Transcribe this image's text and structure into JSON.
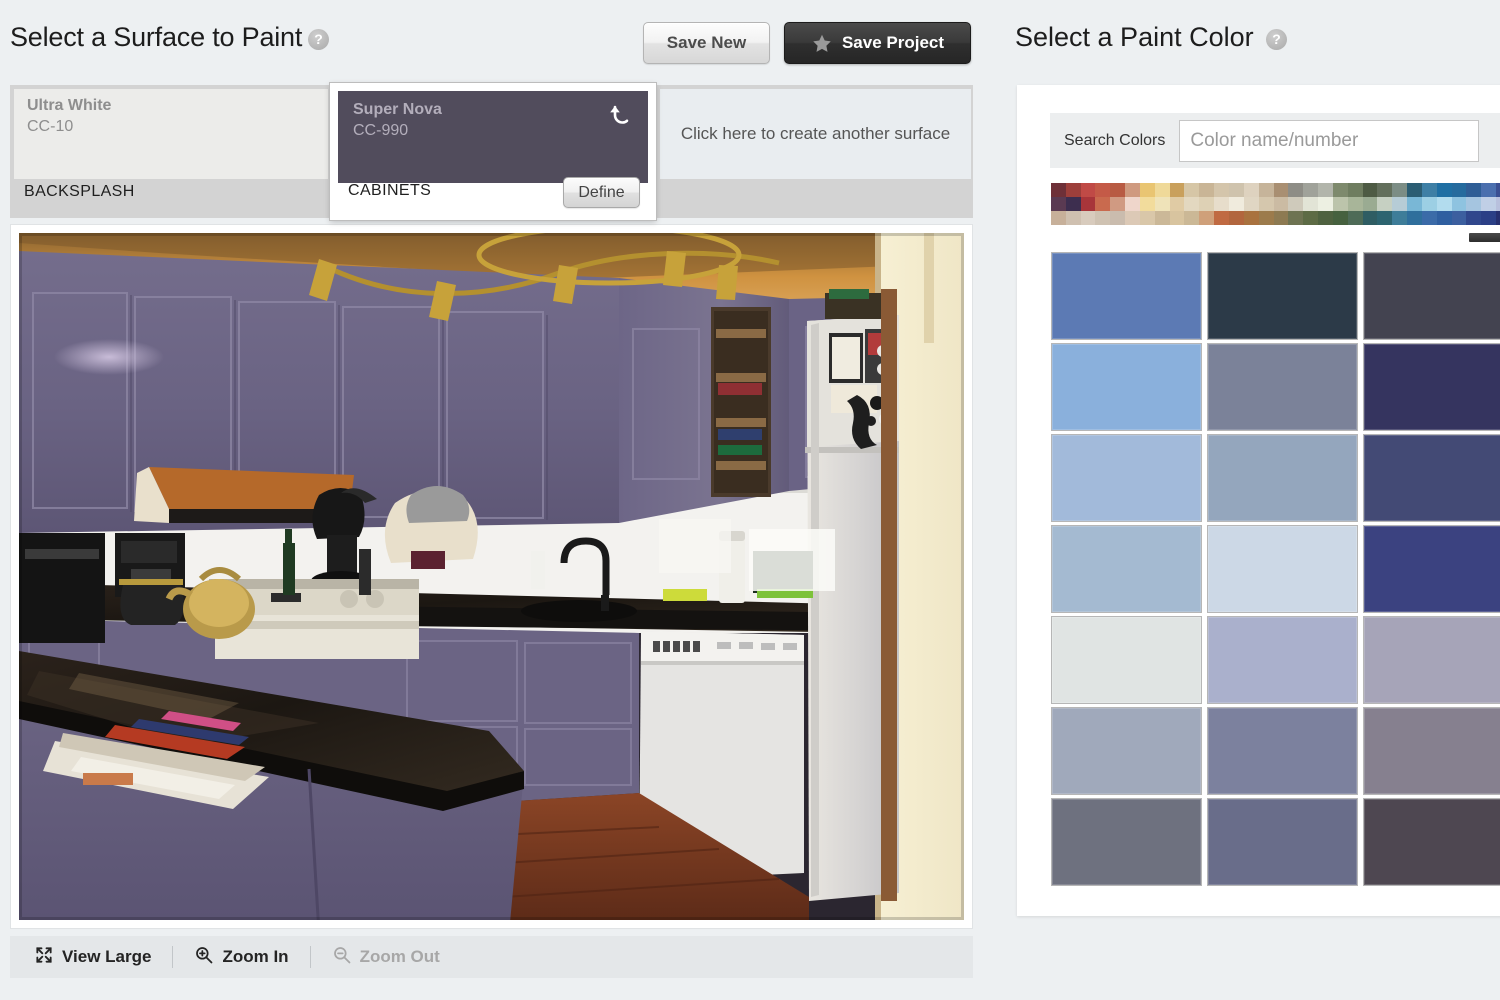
{
  "left": {
    "title": "Select a Surface to Paint",
    "help_icon": "help-question-icon",
    "buttons": {
      "save_new": "Save New",
      "save_project": "Save Project",
      "star_icon": "star-icon"
    },
    "surfaces": [
      {
        "color_name": "Ultra White",
        "color_code": "CC-10",
        "label": "BACKSPLASH",
        "swatch_hex": "#ececea",
        "selected": false
      },
      {
        "color_name": "Super Nova",
        "color_code": "CC-990",
        "label": "CABINETS",
        "swatch_hex": "#514c5c",
        "selected": true,
        "define_label": "Define",
        "undo_icon": "undo-arrow-icon"
      }
    ],
    "add_surface_text": "Click here to create another surface",
    "toolbar": {
      "view_large": "View Large",
      "view_large_icon": "expand-arrows-icon",
      "zoom_in": "Zoom In",
      "zoom_in_icon": "magnifier-plus-icon",
      "zoom_out": "Zoom Out",
      "zoom_out_icon": "magnifier-minus-icon",
      "zoom_out_disabled": true
    },
    "photo": {
      "alt": "kitchen-with-purple-painted-cabinets",
      "cabinet_hex": "#6b6584",
      "ceiling_hex": "#c98e3e",
      "counter_hex": "#241c16",
      "floor_hex": "#7a3420",
      "wall_hex": "#f6efd2",
      "backsplash_hex": "#f2f2ee"
    }
  },
  "right": {
    "title": "Select a Paint Color",
    "help_icon": "help-question-icon",
    "search": {
      "label": "Search Colors",
      "placeholder": "Color name/number",
      "value": ""
    },
    "scroll_thumb_icon": "horizontal-scrollbar-thumb",
    "mini_strip_colors": [
      "#6e3038",
      "#5a3a52",
      "#c7b09a",
      "#9d3f3b",
      "#3d2e4f",
      "#cfc0b0",
      "#c04a46",
      "#a8353a",
      "#d8cbbd",
      "#c45a47",
      "#c96a4e",
      "#cfc2b2",
      "#b85b43",
      "#d09a82",
      "#cabcae",
      "#cf9a7f",
      "#efd6cb",
      "#dcc9b6",
      "#e9c572",
      "#f2dc9c",
      "#d9c7a9",
      "#efd999",
      "#efe3b9",
      "#cbb898",
      "#c9a05c",
      "#e0cba4",
      "#d8c49f",
      "#d6c6a6",
      "#e3d8c0",
      "#cbb896",
      "#c9b596",
      "#ded1b5",
      "#cfa07a",
      "#d4c5ab",
      "#e7ddcb",
      "#c06a42",
      "#cfc3ad",
      "#f0ebdd",
      "#b2663e",
      "#ded2bf",
      "#e0d6c3",
      "#a9723f",
      "#c6b49a",
      "#d5c7ad",
      "#9c7b4c",
      "#a98f72",
      "#cbbba3",
      "#8d7a52",
      "#8e8d86",
      "#cfcabb",
      "#6e7352",
      "#a0a29a",
      "#e2e4d6",
      "#5d6b45",
      "#b2b5ab",
      "#edf0e2",
      "#4f6240",
      "#7e8a6d",
      "#bcc4ab",
      "#46613f",
      "#6f7d60",
      "#a8b599",
      "#4e6b57",
      "#4e5b44",
      "#9aab92",
      "#2f5d63",
      "#636f5c",
      "#c6d0c2",
      "#2d6470",
      "#7c8d85",
      "#b6ccd6",
      "#3e7d99",
      "#2b5d73",
      "#79b7d6",
      "#2f6f9c",
      "#3e7fa5",
      "#9ccfe4",
      "#3b6ba8",
      "#1f6fa3",
      "#b2dcee",
      "#2f5fa0",
      "#256b9e",
      "#8ec3e0",
      "#3c5f9f",
      "#2f5e96",
      "#a5c5e0",
      "#30478c",
      "#4b6fae",
      "#c0cfe6",
      "#2b3f86",
      "#3a4f92",
      "#b8c0dd",
      "#262f6e"
    ],
    "swatches": [
      "#5c7ab4",
      "#2c3a48",
      "#434350",
      "#8ab0dc",
      "#7b8299",
      "#35345f",
      "#a2bada",
      "#94a6bd",
      "#434a75",
      "#a4bad1",
      "#ccd8e6",
      "#3b4280",
      "#e0e4e3",
      "#aab0cc",
      "#a6a4b8",
      "#a0a9bb",
      "#7c819e",
      "#86808f",
      "#6e717f",
      "#696d8a",
      "#4e4751"
    ]
  }
}
